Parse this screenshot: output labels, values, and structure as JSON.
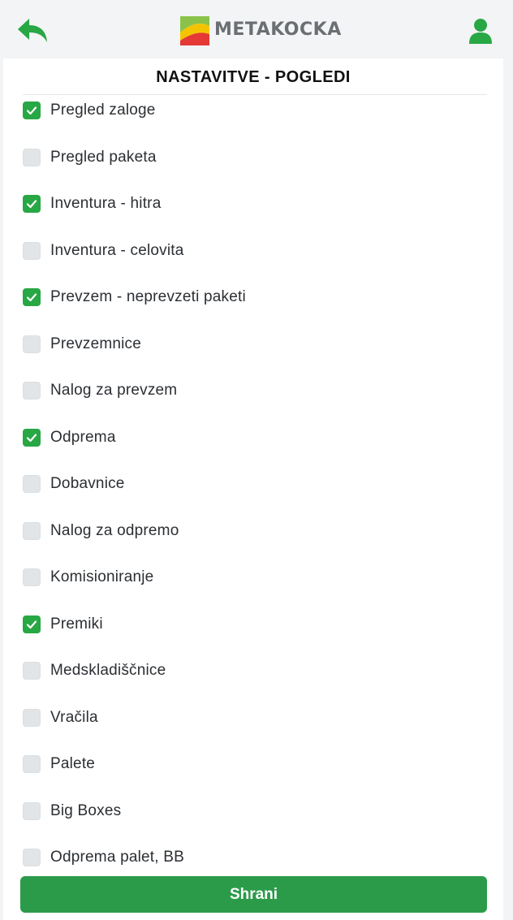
{
  "header": {
    "logo_text": "METAKOCKA",
    "back_icon": "back-arrow-icon",
    "user_icon": "user-icon",
    "accent_color": "#28a745"
  },
  "page": {
    "title": "NASTAVITVE - POGLEDI"
  },
  "views": [
    {
      "label": "Pregled zaloge",
      "checked": true
    },
    {
      "label": "Pregled paketa",
      "checked": false
    },
    {
      "label": "Inventura - hitra",
      "checked": true
    },
    {
      "label": "Inventura - celovita",
      "checked": false
    },
    {
      "label": "Prevzem - neprevzeti paketi",
      "checked": true
    },
    {
      "label": "Prevzemnice",
      "checked": false
    },
    {
      "label": "Nalog za prevzem",
      "checked": false
    },
    {
      "label": "Odprema",
      "checked": true
    },
    {
      "label": "Dobavnice",
      "checked": false
    },
    {
      "label": "Nalog za odpremo",
      "checked": false
    },
    {
      "label": "Komisioniranje",
      "checked": false
    },
    {
      "label": "Premiki",
      "checked": true
    },
    {
      "label": "Medskladiščnice",
      "checked": false
    },
    {
      "label": "Vračila",
      "checked": false
    },
    {
      "label": "Palete",
      "checked": false
    },
    {
      "label": "Big Boxes",
      "checked": false
    },
    {
      "label": "Odprema palet, BB",
      "checked": false
    }
  ],
  "footer": {
    "save_label": "Shrani"
  }
}
